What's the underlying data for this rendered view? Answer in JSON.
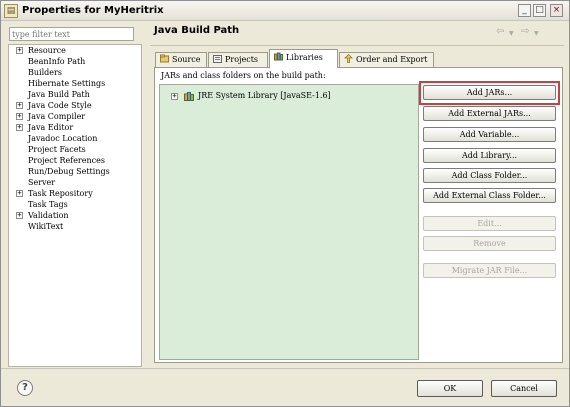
{
  "window": {
    "title": "Properties for MyHeritrix",
    "title_icon": "properties-icon",
    "controls": {
      "minimize": "_",
      "maximize": "□",
      "close": "×"
    }
  },
  "sidebar": {
    "filter_placeholder": "type filter text",
    "items": [
      {
        "label": "Resource",
        "expandable": true
      },
      {
        "label": "BeanInfo Path",
        "expandable": false
      },
      {
        "label": "Builders",
        "expandable": false
      },
      {
        "label": "Hibernate Settings",
        "expandable": false
      },
      {
        "label": "Java Build Path",
        "expandable": false
      },
      {
        "label": "Java Code Style",
        "expandable": true
      },
      {
        "label": "Java Compiler",
        "expandable": true
      },
      {
        "label": "Java Editor",
        "expandable": true
      },
      {
        "label": "Javadoc Location",
        "expandable": false
      },
      {
        "label": "Project Facets",
        "expandable": false
      },
      {
        "label": "Project References",
        "expandable": false
      },
      {
        "label": "Run/Debug Settings",
        "expandable": false
      },
      {
        "label": "Server",
        "expandable": false
      },
      {
        "label": "Task Repository",
        "expandable": true
      },
      {
        "label": "Task Tags",
        "expandable": false
      },
      {
        "label": "Validation",
        "expandable": true
      },
      {
        "label": "WikiText",
        "expandable": false
      }
    ]
  },
  "main": {
    "page_title": "Java Build Path",
    "nav_icons": [
      "back-arrow-icon",
      "dropdown-icon",
      "forward-arrow-icon",
      "dropdown-icon"
    ],
    "tabs": [
      {
        "label": "Source",
        "icon": "source-folder-icon",
        "active": false
      },
      {
        "label": "Projects",
        "icon": "projects-icon",
        "active": false
      },
      {
        "label": "Libraries",
        "icon": "libraries-icon",
        "active": true
      },
      {
        "label": "Order and Export",
        "icon": "order-export-icon",
        "active": false
      }
    ],
    "panel_caption": "JARs and class folders on the build path:",
    "libraries": [
      {
        "label": "JRE System Library [JavaSE-1.6]",
        "icon": "library-icon"
      }
    ],
    "buttons": [
      {
        "label": "Add JARs...",
        "enabled": true,
        "highlighted": true
      },
      {
        "label": "Add External JARs...",
        "enabled": true
      },
      {
        "label": "Add Variable...",
        "enabled": true
      },
      {
        "label": "Add Library...",
        "enabled": true
      },
      {
        "label": "Add Class Folder...",
        "enabled": true
      },
      {
        "label": "Add External Class Folder...",
        "enabled": true
      },
      {
        "label": "Edit...",
        "enabled": false
      },
      {
        "label": "Remove",
        "enabled": false
      },
      {
        "label": "Migrate JAR File...",
        "enabled": false
      }
    ]
  },
  "footer": {
    "help_icon": "?",
    "ok_label": "OK",
    "cancel_label": "Cancel"
  },
  "colors": {
    "list_background": "#d9edd9",
    "highlight_border": "#d13d3d",
    "dialog_background": "#ece9d8"
  }
}
